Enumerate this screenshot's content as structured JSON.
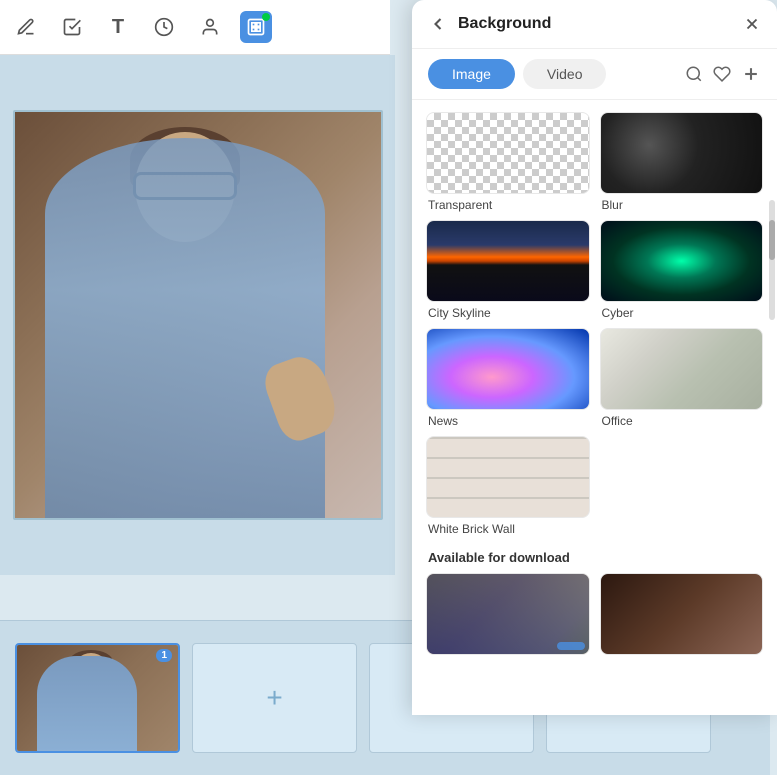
{
  "toolbar": {
    "tools": [
      {
        "name": "pen-tool",
        "label": "✏️",
        "active": false
      },
      {
        "name": "magic-tool",
        "label": "✨",
        "active": false
      },
      {
        "name": "text-tool",
        "label": "T",
        "active": false
      },
      {
        "name": "timer-tool",
        "label": "⏱",
        "active": false
      },
      {
        "name": "person-tool",
        "label": "👤",
        "active": false
      },
      {
        "name": "background-tool",
        "label": "▦",
        "active": true
      }
    ]
  },
  "panel": {
    "title": "Background",
    "back_icon": "←",
    "close_icon": "×",
    "tabs": [
      {
        "label": "Image",
        "active": true
      },
      {
        "label": "Video",
        "active": false
      }
    ],
    "search_placeholder": "Search",
    "backgrounds": [
      {
        "id": "transparent",
        "label": "Transparent",
        "style": "transparent"
      },
      {
        "id": "blur",
        "label": "Blur",
        "style": "blur"
      },
      {
        "id": "city-skyline",
        "label": "City Skyline",
        "style": "city"
      },
      {
        "id": "cyber",
        "label": "Cyber",
        "style": "cyber"
      },
      {
        "id": "news",
        "label": "News",
        "style": "news"
      },
      {
        "id": "office",
        "label": "Office",
        "style": "office"
      },
      {
        "id": "white-brick-wall",
        "label": "White Brick Wall",
        "style": "whitebrick"
      }
    ],
    "available_section": "Available for download",
    "download_items": [
      {
        "id": "dl1",
        "style": "download1"
      },
      {
        "id": "dl2",
        "style": "download2"
      }
    ]
  },
  "thumbnails": [
    {
      "id": "slide1",
      "number": "1",
      "active": true
    },
    {
      "id": "slide-add",
      "label": "+",
      "add": true
    }
  ],
  "colors": {
    "accent": "#4a90e2",
    "panel_bg": "#ffffff",
    "canvas_bg": "#c8dce8"
  }
}
